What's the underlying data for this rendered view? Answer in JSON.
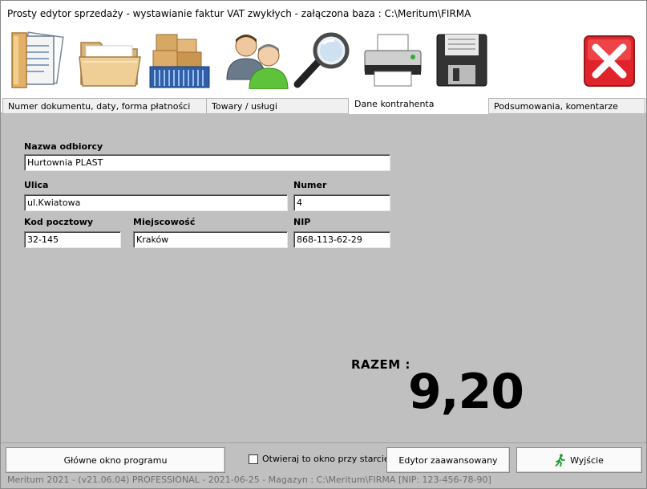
{
  "window": {
    "title": "Prosty edytor sprzedaży - wystawianie faktur VAT zwykłych   -  załączona baza : C:\\Meritum\\FIRMA"
  },
  "toolbar": {
    "buttons": [
      {
        "name": "document-icon"
      },
      {
        "name": "folder-icon"
      },
      {
        "name": "boxes-cart-icon"
      },
      {
        "name": "contractors-icon"
      },
      {
        "name": "magnifier-icon"
      },
      {
        "name": "printer-icon"
      },
      {
        "name": "floppy-save-icon"
      },
      {
        "name": "close-icon",
        "color": "#e0242b"
      }
    ]
  },
  "tabs": [
    {
      "label": "Numer dokumentu, daty, forma płatności",
      "active": false
    },
    {
      "label": "Towary  / usługi",
      "active": false
    },
    {
      "label": "Dane kontrahenta",
      "active": true
    },
    {
      "label": "Podsumowania, komentarze",
      "active": false
    }
  ],
  "form": {
    "recipient_name": {
      "label": "Nazwa odbiorcy",
      "value": "Hurtownia PLAST"
    },
    "street": {
      "label": "Ulica",
      "value": "ul.Kwiatowa"
    },
    "number": {
      "label": "Numer",
      "value": "4"
    },
    "postal_code": {
      "label": "Kod pocztowy",
      "value": "32-145"
    },
    "city": {
      "label": "Miejscowość",
      "value": "Kraków"
    },
    "nip": {
      "label": "NIP",
      "value": "868-113-62-29"
    }
  },
  "total": {
    "label": "RAZEM  :",
    "value": "9,20"
  },
  "bottom": {
    "main_window_label": "Główne okno programu",
    "open_on_start_label": "Otwieraj to okno przy starcie",
    "open_on_start_checked": false,
    "advanced_editor_label": "Edytor zaawansowany",
    "exit_label": "Wyjście"
  },
  "status": {
    "text": "Meritum 2021   -   (v21.06.04) PROFESSIONAL  -  2021-06-25  -  Magazyn :  C:\\Meritum\\FIRMA   [NIP: 123-456-78-90]"
  }
}
